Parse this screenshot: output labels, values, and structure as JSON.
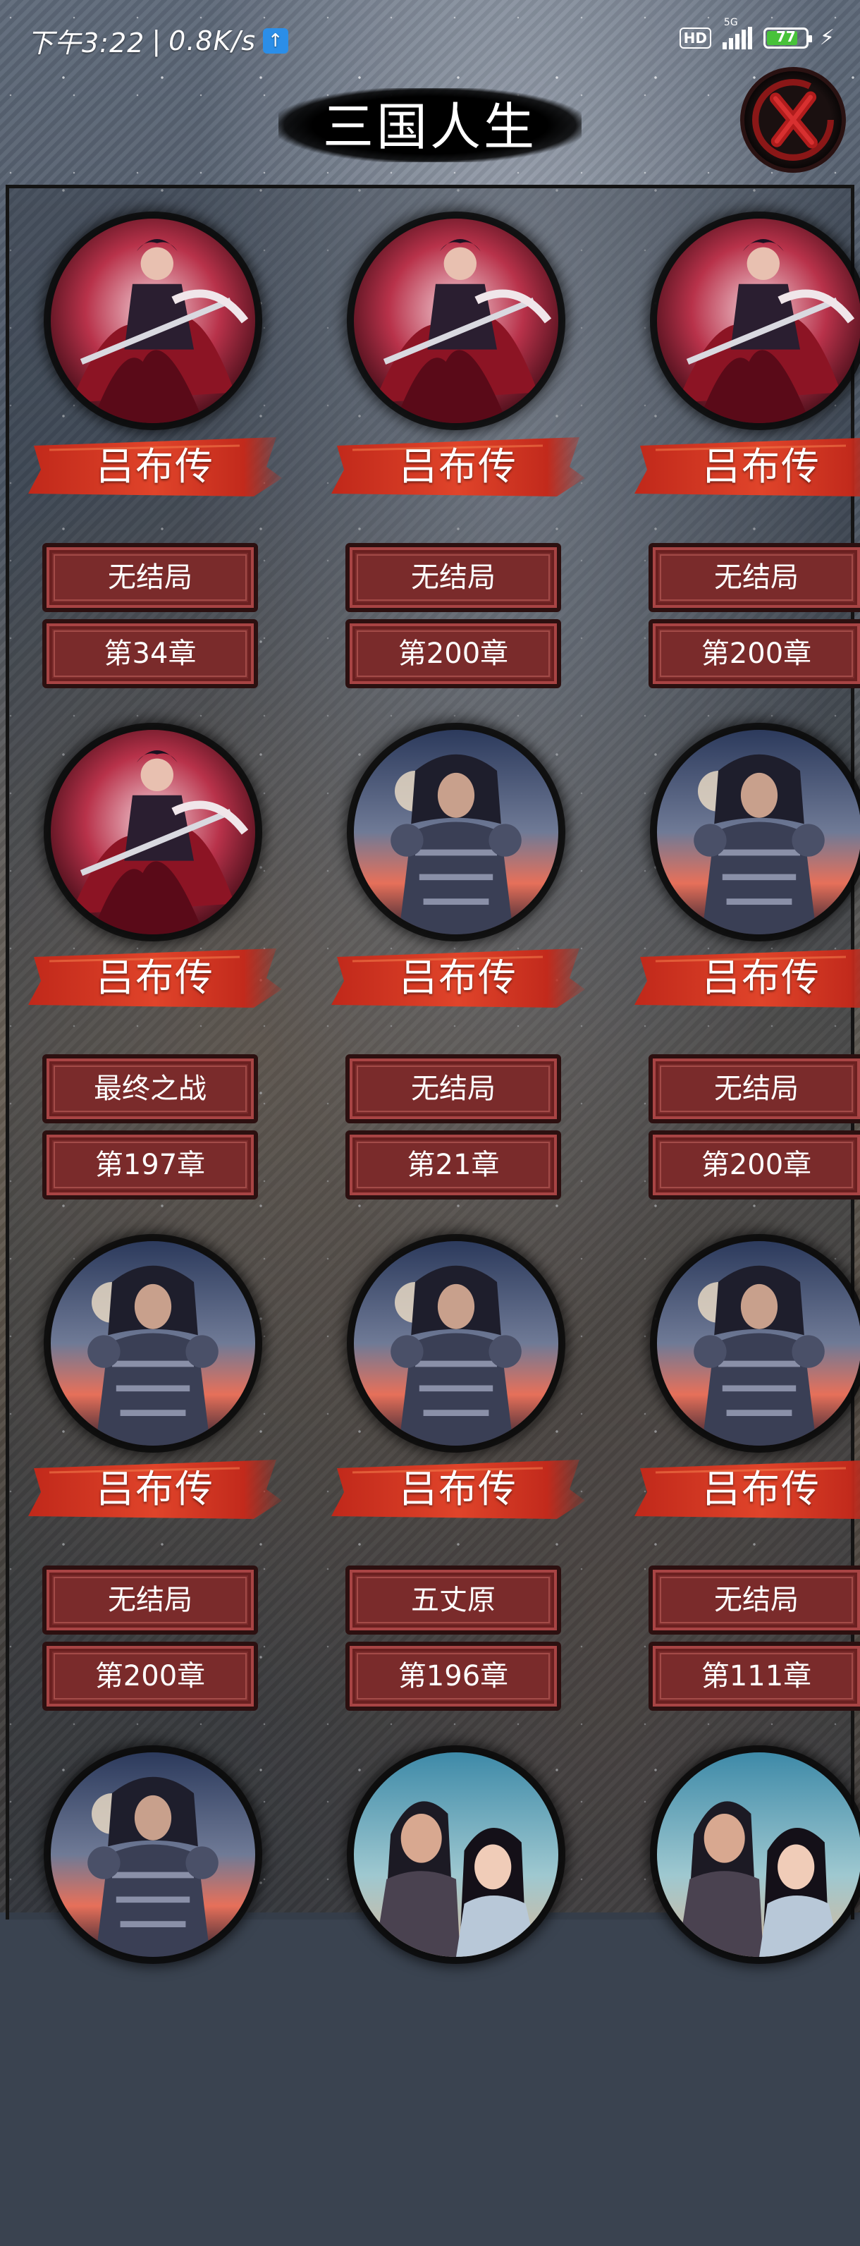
{
  "status_bar": {
    "time": "下午3:22",
    "speed": "0.8K/s",
    "hd": "HD",
    "network": "5G",
    "battery": "77"
  },
  "title": "三国人生",
  "cards": [
    {
      "name": "吕布传",
      "ending": "无结局",
      "chapter": "第34章",
      "portrait": "red-warrior"
    },
    {
      "name": "吕布传",
      "ending": "无结局",
      "chapter": "第200章",
      "portrait": "red-warrior"
    },
    {
      "name": "吕布传",
      "ending": "无结局",
      "chapter": "第200章",
      "portrait": "red-warrior"
    },
    {
      "name": "吕布传",
      "ending": "最终之战",
      "chapter": "第197章",
      "portrait": "red-warrior"
    },
    {
      "name": "吕布传",
      "ending": "无结局",
      "chapter": "第21章",
      "portrait": "armored-warrior"
    },
    {
      "name": "吕布传",
      "ending": "无结局",
      "chapter": "第200章",
      "portrait": "armored-warrior"
    },
    {
      "name": "吕布传",
      "ending": "无结局",
      "chapter": "第200章",
      "portrait": "armored-warrior"
    },
    {
      "name": "吕布传",
      "ending": "五丈原",
      "chapter": "第196章",
      "portrait": "armored-warrior"
    },
    {
      "name": "吕布传",
      "ending": "无结局",
      "chapter": "第111章",
      "portrait": "armored-warrior"
    },
    {
      "name": "",
      "ending": "",
      "chapter": "",
      "portrait": "armored-warrior"
    },
    {
      "name": "",
      "ending": "",
      "chapter": "",
      "portrait": "couple"
    },
    {
      "name": "",
      "ending": "",
      "chapter": "",
      "portrait": "couple"
    }
  ]
}
